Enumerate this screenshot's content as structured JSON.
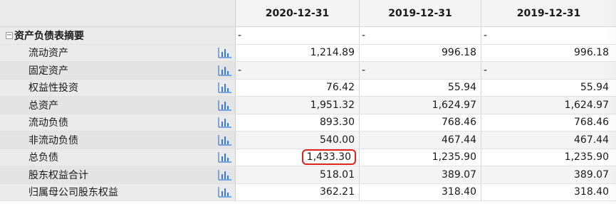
{
  "columns": [
    "2020-12-31",
    "2019-12-31",
    "2019-12-31"
  ],
  "section": {
    "label": "资产负债表摘要",
    "values": [
      "-",
      "-",
      "-"
    ],
    "expander": "−"
  },
  "rows": [
    {
      "label": "流动资产",
      "values": [
        "1,214.89",
        "996.18",
        "996.18"
      ]
    },
    {
      "label": "固定资产",
      "values": [
        "-",
        "-",
        "-"
      ]
    },
    {
      "label": "权益性投资",
      "values": [
        "76.42",
        "55.94",
        "55.94"
      ]
    },
    {
      "label": "总资产",
      "values": [
        "1,951.32",
        "1,624.97",
        "1,624.97"
      ]
    },
    {
      "label": "流动负债",
      "values": [
        "893.30",
        "768.46",
        "768.46"
      ]
    },
    {
      "label": "非流动负债",
      "values": [
        "540.00",
        "467.44",
        "467.44"
      ]
    },
    {
      "label": "总负债",
      "values": [
        "1,433.30",
        "1,235.90",
        "1,235.90"
      ],
      "highlight_first": true
    },
    {
      "label": "股东权益合计",
      "values": [
        "518.01",
        "389.07",
        "389.07"
      ]
    },
    {
      "label": "归属母公司股东权益",
      "values": [
        "362.21",
        "318.40",
        "318.40"
      ]
    }
  ],
  "icons": {
    "row_chart": "bar-chart-icon"
  },
  "colors": {
    "highlight": "#e0241c",
    "icon": "#3a7bd5"
  }
}
